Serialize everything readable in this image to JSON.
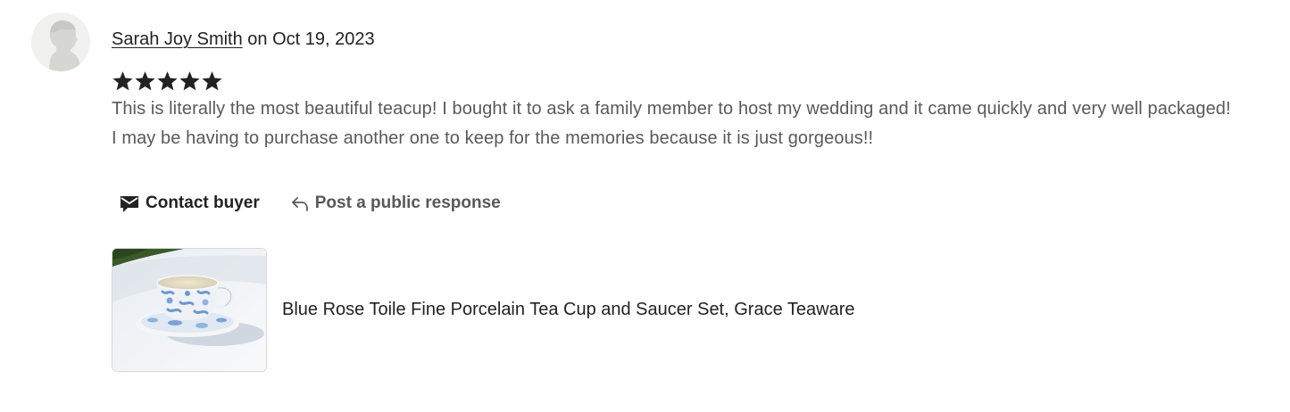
{
  "review": {
    "reviewer_name": "Sarah Joy Smith",
    "date_text": " on Oct 19, 2023",
    "rating": 5,
    "rating_max": 5,
    "text_line_1": "This is literally the most beautiful teacup! I bought it to ask a family member to host my wedding and it came quickly and very well packaged!",
    "text_line_2": "I may be having to purchase another one to keep for the memories because it is just gorgeous!!"
  },
  "actions": {
    "contact_label": "Contact buyer",
    "contact_icon": "envelope-icon",
    "respond_label": "Post a public response",
    "respond_icon": "reply-arrow-icon"
  },
  "product": {
    "title": "Blue Rose Toile Fine Porcelain Tea Cup and Saucer Set, Grace Teaware",
    "image_icon": "teacup-photo"
  },
  "colors": {
    "star": "#222222",
    "text_primary": "#222222",
    "text_secondary": "#595959",
    "avatar_bg": "#f1f1ef",
    "avatar_figure": "#d6d6d2"
  }
}
